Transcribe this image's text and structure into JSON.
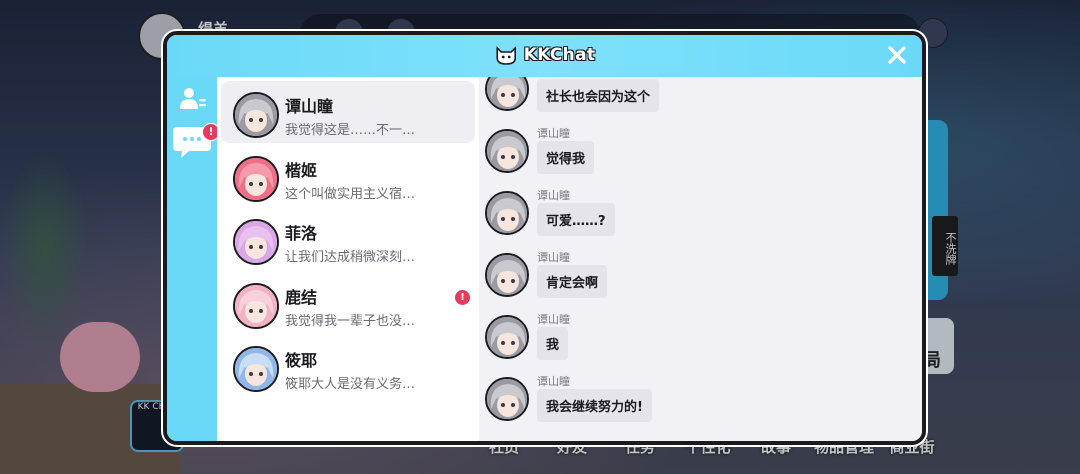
{
  "background": {
    "player_name": "缇羊",
    "side_tag": "不洗牌",
    "right_button_label": "局",
    "kk_button_label": "KK CHAT",
    "bottom_nav": [
      "社员",
      "好友",
      "任务",
      "个性化",
      "故事",
      "物品管理",
      "商业街"
    ]
  },
  "window": {
    "title": "KKChat",
    "logo_icon": "cat-face-icon",
    "close_icon": "close-icon",
    "theme_color": "#6ad9f8",
    "alert_color": "#e83a5d"
  },
  "sidebar": {
    "contacts_icon": "person-list-icon",
    "chat_icon": "chat-bubble-icon",
    "chat_alert": "!"
  },
  "contacts": [
    {
      "name": "谭山瞳",
      "preview": "我觉得这是……不一…",
      "active": true,
      "alert": "",
      "avatar_color": "#9a9aa2",
      "hair": "#c9c9cf"
    },
    {
      "name": "楷姬",
      "preview": "这个叫做实用主义宿…",
      "active": false,
      "alert": "",
      "avatar_color": "#f06e86",
      "hair": "#f59aaa"
    },
    {
      "name": "菲洛",
      "preview": "让我们达成稍微深刻…",
      "active": false,
      "alert": "",
      "avatar_color": "#d9a7e6",
      "hair": "#e8c1f0"
    },
    {
      "name": "鹿结",
      "preview": "我觉得我一辈子也没…",
      "active": false,
      "alert": "!",
      "avatar_color": "#f3b1c4",
      "hair": "#f7d0dc"
    },
    {
      "name": "筱耶",
      "preview": "筱耶大人是没有义务…",
      "active": false,
      "alert": "",
      "avatar_color": "#8fb7e8",
      "hair": "#c8def5"
    }
  ],
  "messages": [
    {
      "sender": "谭山瞳",
      "text": "社长也会因为这个"
    },
    {
      "sender": "谭山瞳",
      "text": "觉得我"
    },
    {
      "sender": "谭山瞳",
      "text": "可爱……?"
    },
    {
      "sender": "谭山瞳",
      "text": "肯定会啊"
    },
    {
      "sender": "谭山瞳",
      "text": "我"
    },
    {
      "sender": "谭山瞳",
      "text": "我会继续努力的!"
    }
  ]
}
